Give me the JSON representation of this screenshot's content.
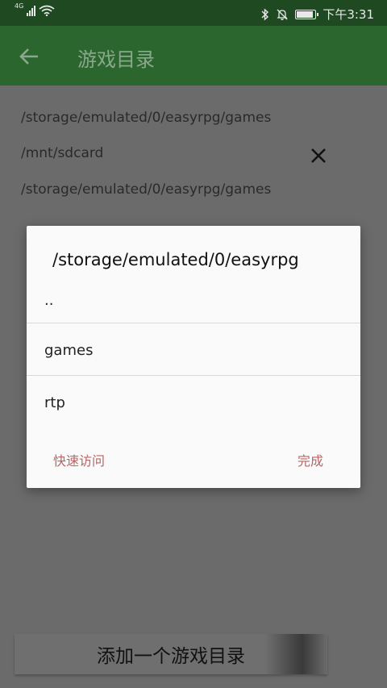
{
  "status_bar": {
    "network": "4G",
    "time": "下午3:31"
  },
  "app_bar": {
    "title": "游戏目录",
    "back_icon": "arrow-left-icon"
  },
  "directories": [
    "/storage/emulated/0/easyrpg/games",
    "/mnt/sdcard",
    "/storage/emulated/0/easyrpg/games"
  ],
  "add_button": {
    "label": "添加一个游戏目录"
  },
  "dialog": {
    "title": "/storage/emulated/0/easyrpg",
    "items": [
      "..",
      "games",
      "rtp"
    ],
    "quick_access_label": "快速访问",
    "done_label": "完成"
  },
  "colors": {
    "app_bar": "#2b662e",
    "status_bar": "#1f4a21",
    "dialog_action": "#b76565"
  }
}
